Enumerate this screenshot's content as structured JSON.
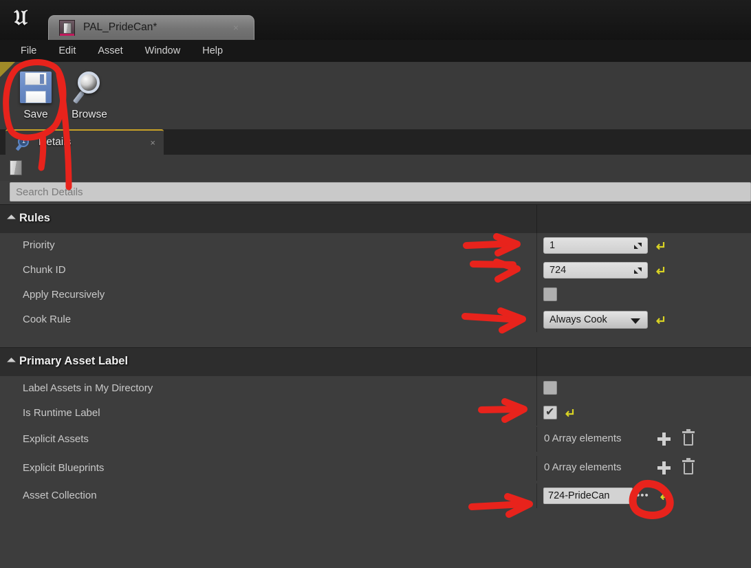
{
  "app": {
    "logo_icon": "unreal-engine-logo",
    "tab": {
      "title": "PAL_PrideCan*",
      "icon": "asset-box-icon",
      "close_icon": "×"
    }
  },
  "menubar": {
    "items": [
      {
        "label": "File"
      },
      {
        "label": "Edit"
      },
      {
        "label": "Asset"
      },
      {
        "label": "Window"
      },
      {
        "label": "Help"
      }
    ]
  },
  "toolbar": {
    "buttons": [
      {
        "label": "Save",
        "icon": "floppy-disk-save-icon"
      },
      {
        "label": "Browse",
        "icon": "magnifier-browse-icon"
      }
    ]
  },
  "details_panel": {
    "tab_label": "Details",
    "tab_icon": "magnifier-badge-1-icon",
    "tab_badge": "1",
    "tab_close_icon": "×",
    "breadcrumb_icon": "asset-box-icon",
    "search": {
      "placeholder": "Search Details",
      "value": ""
    }
  },
  "sections": [
    {
      "id": "rules",
      "title": "Rules",
      "collapse_icon": "triangle-down-icon",
      "rows": [
        {
          "label": "Priority",
          "widget": "number",
          "value": "1",
          "spinner_icon": "spinner-drag-icon",
          "reset_icon": "reset-arrow-icon",
          "has_reset": true
        },
        {
          "label": "Chunk ID",
          "widget": "number",
          "value": "724",
          "spinner_icon": "spinner-drag-icon",
          "reset_icon": "reset-arrow-icon",
          "has_reset": true
        },
        {
          "label": "Apply Recursively",
          "widget": "checkbox",
          "checked": false,
          "has_reset": false
        },
        {
          "label": "Cook Rule",
          "widget": "dropdown",
          "value": "Always Cook",
          "dropdown_icon": "chevron-down-icon",
          "reset_icon": "reset-arrow-icon",
          "has_reset": true
        }
      ]
    },
    {
      "id": "primary_asset_label",
      "title": "Primary Asset Label",
      "collapse_icon": "triangle-down-icon",
      "rows": [
        {
          "label": "Label Assets in My Directory",
          "widget": "checkbox",
          "checked": false,
          "has_reset": false
        },
        {
          "label": "Is Runtime Label",
          "widget": "checkbox",
          "checked": true,
          "reset_icon": "reset-arrow-icon",
          "has_reset": true
        },
        {
          "label": "Explicit Assets",
          "widget": "array",
          "value": "0 Array elements",
          "add_icon": "plus-icon",
          "delete_icon": "trash-icon",
          "has_reset": false
        },
        {
          "label": "Explicit Blueprints",
          "widget": "array",
          "value": "0 Array elements",
          "add_icon": "plus-icon",
          "delete_icon": "trash-icon",
          "has_reset": false
        },
        {
          "label": "Asset Collection",
          "widget": "text",
          "value": "724-PrideCan",
          "ellipsis_icon": "ellipsis-icon",
          "reset_icon": "reset-arrow-icon",
          "has_reset": true
        }
      ]
    }
  ],
  "annotations": {
    "color": "#e8231c",
    "shapes": [
      {
        "type": "ellipse",
        "target": "save-button"
      },
      {
        "type": "arrow",
        "target": "priority-value"
      },
      {
        "type": "arrow",
        "target": "chunk-id-value"
      },
      {
        "type": "arrow",
        "target": "cook-rule-value"
      },
      {
        "type": "arrow",
        "target": "is-runtime-label-value"
      },
      {
        "type": "arrow",
        "target": "asset-collection-value"
      },
      {
        "type": "blob",
        "target": "asset-collection-ellipsis-button"
      }
    ]
  },
  "colors": {
    "panel_bg": "#3d3d3d",
    "section_bg": "#2d2d2d",
    "menu_bg": "#171717",
    "toolbar_bg": "#3a3a3a",
    "accent_yellow": "#c8a227",
    "annotation_red": "#e8231c",
    "field_bg": "#cfcfcf"
  }
}
